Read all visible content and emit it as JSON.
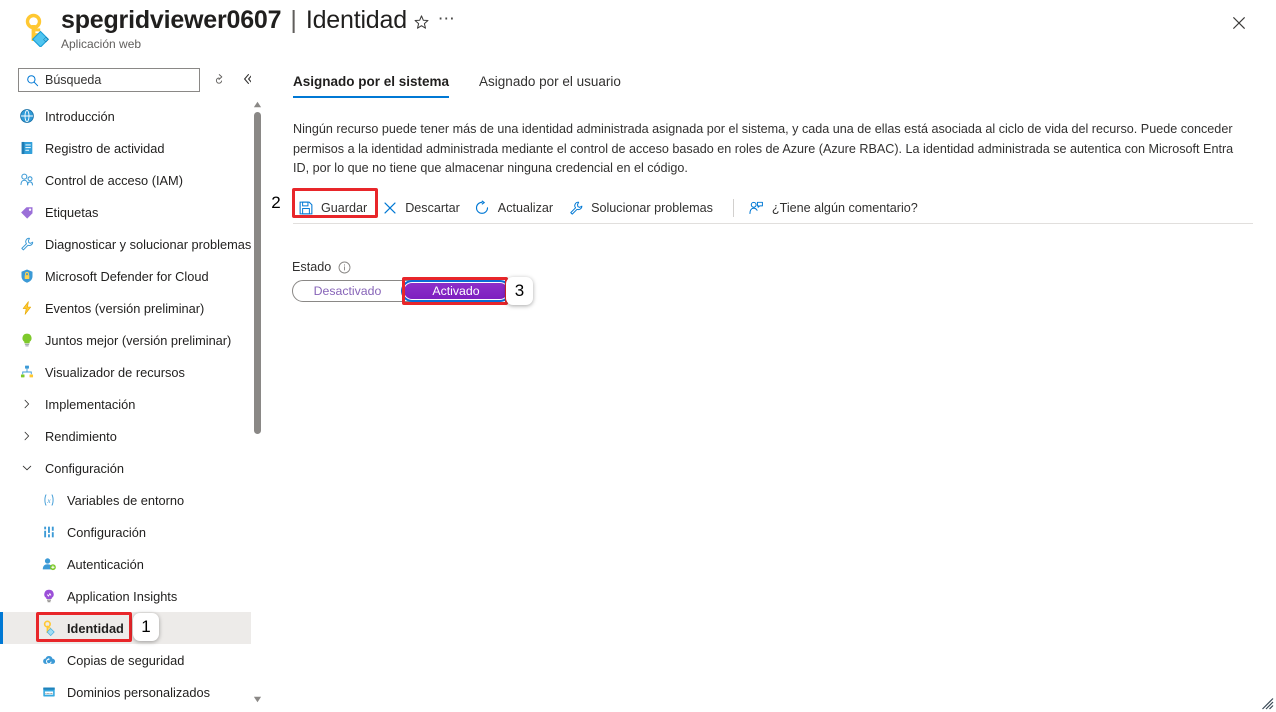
{
  "header": {
    "resource_icon": "key-icon",
    "title": "spegridviewer0607",
    "title_separator": "|",
    "section": "Identidad",
    "subtitle": "Aplicación web",
    "favorite_icon": "star-icon",
    "more_icon": "ellipsis-icon",
    "close_icon": "close-icon"
  },
  "sidebar": {
    "search": {
      "placeholder": "Búsqueda",
      "value": "",
      "icon": "search-icon"
    },
    "refresh_icon": "refresh-icon",
    "collapse_icon": "double-chevron-left-icon",
    "items": [
      {
        "label": "Introducción",
        "icon": "globe-icon",
        "level": 0,
        "selected": false
      },
      {
        "label": "Registro de actividad",
        "icon": "activity-log-icon",
        "level": 0,
        "selected": false
      },
      {
        "label": "Control de acceso (IAM)",
        "icon": "people-icon",
        "level": 0,
        "selected": false
      },
      {
        "label": "Etiquetas",
        "icon": "tag-icon",
        "level": 0,
        "selected": false
      },
      {
        "label": "Diagnosticar y solucionar problemas",
        "icon": "wrench-icon",
        "level": 0,
        "selected": false
      },
      {
        "label": "Microsoft Defender for Cloud",
        "icon": "shield-icon",
        "level": 0,
        "selected": false
      },
      {
        "label": "Eventos (versión preliminar)",
        "icon": "lightning-icon",
        "level": 0,
        "selected": false
      },
      {
        "label": "Juntos mejor (versión preliminar)",
        "icon": "lightbulb-icon",
        "level": 0,
        "selected": false
      },
      {
        "label": "Visualizador de recursos",
        "icon": "resource-graph-icon",
        "level": 0,
        "selected": false
      }
    ],
    "groups": [
      {
        "label": "Implementación",
        "icon": "chevron-right-icon",
        "expanded": false
      },
      {
        "label": "Rendimiento",
        "icon": "chevron-right-icon",
        "expanded": false
      },
      {
        "label": "Configuración",
        "icon": "chevron-down-icon",
        "expanded": true
      }
    ],
    "config_items": [
      {
        "label": "Variables de entorno",
        "icon": "variable-icon",
        "selected": false
      },
      {
        "label": "Configuración",
        "icon": "settings-bars-icon",
        "selected": false
      },
      {
        "label": "Autenticación",
        "icon": "user-add-icon",
        "selected": false
      },
      {
        "label": "Application Insights",
        "icon": "app-insights-icon",
        "selected": false
      },
      {
        "label": "Identidad",
        "icon": "key-icon",
        "selected": true
      },
      {
        "label": "Copias de seguridad",
        "icon": "backup-cloud-icon",
        "selected": false
      },
      {
        "label": "Dominios personalizados",
        "icon": "custom-domain-icon",
        "selected": false
      }
    ]
  },
  "main": {
    "tabs": [
      {
        "label": "Asignado por el sistema",
        "active": true
      },
      {
        "label": "Asignado por el usuario",
        "active": false
      }
    ],
    "description": "Ningún recurso puede tener más de una identidad administrada asignada por el sistema, y cada una de ellas está asociada al ciclo de vida del recurso. Puede conceder permisos a la identidad administrada mediante el control de acceso basado en roles de Azure (Azure RBAC). La identidad administrada se autentica con Microsoft Entra ID, por lo que no tiene que almacenar ninguna credencial en el código.",
    "commands": [
      {
        "label": "Guardar",
        "icon": "save-icon"
      },
      {
        "label": "Descartar",
        "icon": "cancel-x-icon"
      },
      {
        "label": "Actualizar",
        "icon": "refresh-icon"
      },
      {
        "label": "Solucionar problemas",
        "icon": "wrench-icon"
      },
      {
        "label": "¿Tiene algún comentario?",
        "icon": "feedback-person-icon"
      }
    ],
    "status": {
      "label": "Estado",
      "info_icon": "info-icon",
      "off_label": "Desactivado",
      "on_label": "Activado",
      "selected": "Activado"
    }
  },
  "annotations": [
    {
      "number": "1",
      "target": "sidebar-item-identidad"
    },
    {
      "number": "2",
      "target": "save-command"
    },
    {
      "number": "3",
      "target": "status-toggle-on"
    }
  ],
  "colors": {
    "accent": "#0078d4",
    "annotation": "#e8262a",
    "toggle_on_bg": "#8a2be2",
    "toggle_off_text": "#8764b8",
    "selected_row_bg": "#edebe9"
  }
}
